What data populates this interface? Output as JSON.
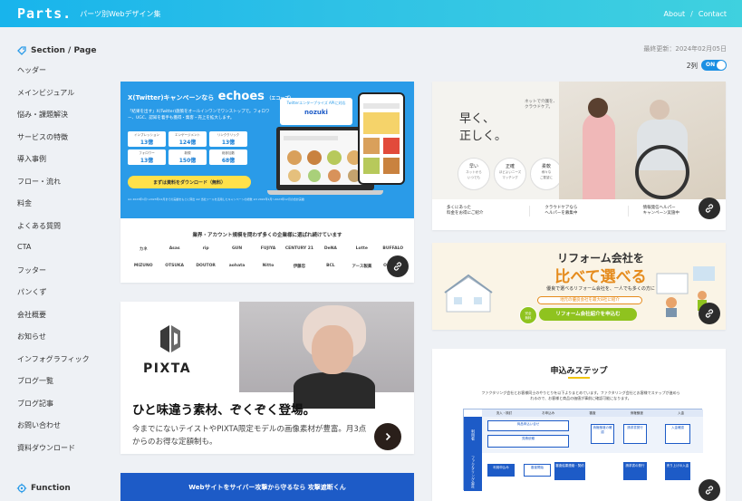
{
  "header": {
    "logo": "Parts.",
    "tagline": "パーツ別Webデザイン集",
    "nav": [
      "About",
      "/",
      "Contact"
    ]
  },
  "sidebar": {
    "section_title": "Section / Page",
    "items": [
      "ヘッダー",
      "メインビジュアル",
      "悩み・課題解決",
      "サービスの特徴",
      "導入事例",
      "フロー・流れ",
      "料金",
      "よくある質問",
      "CTA",
      "フッター",
      "パンくず",
      "会社概要",
      "お知らせ",
      "インフォグラフィック",
      "ブログ一覧",
      "ブログ記事",
      "お問い合わせ",
      "資料ダウンロード"
    ],
    "function_title": "Function"
  },
  "main": {
    "updated": "最終更新：2024年02月05日",
    "columns_label": "2列",
    "toggle_label": "ON"
  },
  "cards": {
    "echoes": {
      "title_pre": "X(Twitter)キャンペーンなら",
      "title_brand": "echoes",
      "title_post": "（エコーズ）",
      "sub": "「結果を出す」X(Twitter)施策をオールインワンでワンストップで。フォロワー、UGC、認知を着手も獲得・集客・売上を拡大します。",
      "stats": [
        {
          "label": "インプレッション",
          "value": "13億"
        },
        {
          "label": "エンゲージメント",
          "value": "124億"
        },
        {
          "label": "リンククリック",
          "value": "13億"
        },
        {
          "label": "フォロワー",
          "value": "13億"
        },
        {
          "label": "新規",
          "value": "150億"
        },
        {
          "label": "総参加数",
          "value": "68億"
        }
      ],
      "cta": "まずは資料をダウンロード（無料）",
      "fine": "※1 2023年1月〜2023年12月までの実績をもとに算出 ※2 当社ツールを活用したキャンペーンの総数 ※3 2022年1月〜2023年12月の合計実績",
      "bubble": "Twitterエンタープライズ APIに対応",
      "bubble_brand": "nozuki",
      "bottom_title": "業界・アカウント規模を問わず多くの企業様に選ばれ続けています",
      "logos": [
        "カネ",
        "Asas",
        "rip",
        "GUN",
        "FUJIYA",
        "CENTURY 21",
        "DeNA",
        "Lotte",
        "BUFFALO",
        "MIZUNO",
        "OTSUKA",
        "DOUTOR",
        "aohata",
        "Nitto",
        "伊藤忠",
        "BCL",
        "アース製薬",
        "ORIHICA"
      ]
    },
    "pixta": {
      "brand": "PIXTA",
      "headline": "ひと味違う素材、ぞくぞく登場。",
      "text": "今までにないテイストやPIXTA限定モデルの画像素材が豊富。月3点からのお得な定額制も。"
    },
    "security": {
      "text": "Webサイトをサイバー攻撃から守るなら 攻撃遮断くん"
    },
    "care": {
      "title": "早く、\n正しく。",
      "vertical": "ネットで介護を、クラウドケア。",
      "circles": [
        {
          "title": "早い",
          "sub": "ネットから\nいつでも"
        },
        {
          "title": "正確",
          "sub": "ほどよいニーズ\nマッチング"
        },
        {
          "title": "柔軟",
          "sub": "様々な\nご要望に"
        }
      ],
      "strip": [
        "多くにあった\n料金をお得にご紹介",
        "クラウドケアなら\nヘルパーを募集中",
        "情報発信ヘルパー\nキャンペーン実施中"
      ]
    },
    "reform": {
      "title1": "リフォーム会社を",
      "title2": "比べて選べる",
      "sub": "優良で選べるリフォーム会社を、一人でも多くの方に",
      "pill": "地元の優良会社を最大8社に紹介",
      "badge": "完全\n無料",
      "button": "リフォーム会社紹介を申込む"
    },
    "steps": {
      "title": "申込みステップ",
      "desc": "ファクタリング会社とお客様同士のやりとりを以下よりまとめています。ファクタリング会社とお客様でステップが進められるので、お客様と商品の価値が事前に確認可能になります。",
      "headers": [
        "流入・検討",
        "お申込み",
        "審査",
        "債権譲渡",
        "入金"
      ],
      "lane1": "利用者",
      "lane2": "ファクタリング会社",
      "boxes": [
        "商品申込い合せ",
        "見積依頼",
        "債権譲渡の確認",
        "請求書発行",
        "入金確認",
        "利用申込み",
        "審査開始",
        "審査結果連絡・契約",
        "請求書の発行",
        "売り上げの入金"
      ]
    }
  }
}
